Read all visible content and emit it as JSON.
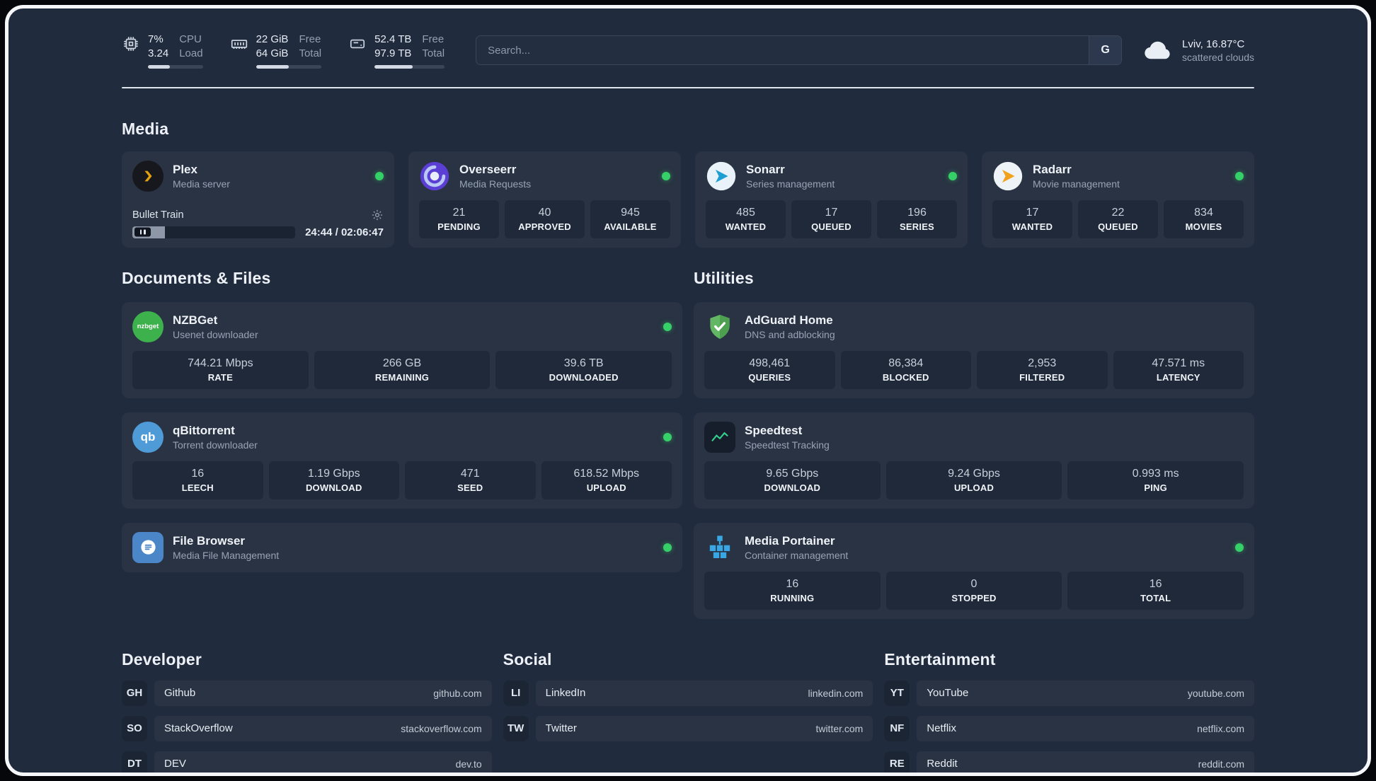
{
  "topbar": {
    "cpu": {
      "percent": "7%",
      "load": "3.24",
      "label_top": "CPU",
      "label_bottom": "Load",
      "bar_percent": 40
    },
    "ram": {
      "free": "22 GiB",
      "total": "64 GiB",
      "label_top": "Free",
      "label_bottom": "Total",
      "bar_percent": 50
    },
    "disk": {
      "free": "52.4 TB",
      "total": "97.9 TB",
      "label_top": "Free",
      "label_bottom": "Total",
      "bar_percent": 54
    },
    "search": {
      "placeholder": "Search...",
      "engine_label": "G"
    },
    "weather": {
      "location": "Lviv, 16.87°C",
      "condition": "scattered clouds",
      "icon": "cloud-icon"
    }
  },
  "sections": {
    "media": {
      "title": "Media",
      "plex": {
        "name": "Plex",
        "subtitle": "Media server",
        "icon": "plex-icon",
        "status": "online",
        "player": {
          "title": "Bullet Train",
          "time": "24:44 / 02:06:47",
          "progress_percent": 20
        }
      },
      "overseerr": {
        "name": "Overseerr",
        "subtitle": "Media Requests",
        "icon": "overseerr-icon",
        "status": "online",
        "stats": [
          {
            "value": "21",
            "label": "PENDING"
          },
          {
            "value": "40",
            "label": "APPROVED"
          },
          {
            "value": "945",
            "label": "AVAILABLE"
          }
        ]
      },
      "sonarr": {
        "name": "Sonarr",
        "subtitle": "Series management",
        "icon": "sonarr-icon",
        "status": "online",
        "stats": [
          {
            "value": "485",
            "label": "WANTED"
          },
          {
            "value": "17",
            "label": "QUEUED"
          },
          {
            "value": "196",
            "label": "SERIES"
          }
        ]
      },
      "radarr": {
        "name": "Radarr",
        "subtitle": "Movie management",
        "icon": "radarr-icon",
        "status": "online",
        "stats": [
          {
            "value": "17",
            "label": "WANTED"
          },
          {
            "value": "22",
            "label": "QUEUED"
          },
          {
            "value": "834",
            "label": "MOVIES"
          }
        ]
      }
    },
    "documents": {
      "title": "Documents & Files",
      "nzbget": {
        "name": "NZBGet",
        "subtitle": "Usenet downloader",
        "icon": "nzbget-icon",
        "status": "online",
        "stats": [
          {
            "value": "744.21 Mbps",
            "label": "RATE"
          },
          {
            "value": "266 GB",
            "label": "REMAINING"
          },
          {
            "value": "39.6 TB",
            "label": "DOWNLOADED"
          }
        ]
      },
      "qbittorrent": {
        "name": "qBittorrent",
        "subtitle": "Torrent downloader",
        "icon": "qbittorrent-icon",
        "status": "online",
        "stats": [
          {
            "value": "16",
            "label": "LEECH"
          },
          {
            "value": "1.19 Gbps",
            "label": "DOWNLOAD"
          },
          {
            "value": "471",
            "label": "SEED"
          },
          {
            "value": "618.52 Mbps",
            "label": "UPLOAD"
          }
        ]
      },
      "filebrowser": {
        "name": "File Browser",
        "subtitle": "Media File Management",
        "icon": "filebrowser-icon",
        "status": "online"
      }
    },
    "utilities": {
      "title": "Utilities",
      "adguard": {
        "name": "AdGuard Home",
        "subtitle": "DNS and adblocking",
        "icon": "adguard-icon",
        "stats": [
          {
            "value": "498,461",
            "label": "QUERIES"
          },
          {
            "value": "86,384",
            "label": "BLOCKED"
          },
          {
            "value": "2,953",
            "label": "FILTERED"
          },
          {
            "value": "47.571 ms",
            "label": "LATENCY"
          }
        ]
      },
      "speedtest": {
        "name": "Speedtest",
        "subtitle": "Speedtest Tracking",
        "icon": "speedtest-icon",
        "stats": [
          {
            "value": "9.65 Gbps",
            "label": "DOWNLOAD"
          },
          {
            "value": "9.24 Gbps",
            "label": "UPLOAD"
          },
          {
            "value": "0.993 ms",
            "label": "PING"
          }
        ]
      },
      "portainer": {
        "name": "Media Portainer",
        "subtitle": "Container management",
        "icon": "portainer-icon",
        "status": "online",
        "stats": [
          {
            "value": "16",
            "label": "RUNNING"
          },
          {
            "value": "0",
            "label": "STOPPED"
          },
          {
            "value": "16",
            "label": "TOTAL"
          }
        ]
      }
    }
  },
  "bookmarks": {
    "developer": {
      "title": "Developer",
      "items": [
        {
          "abbr": "GH",
          "name": "Github",
          "url": "github.com"
        },
        {
          "abbr": "SO",
          "name": "StackOverflow",
          "url": "stackoverflow.com"
        },
        {
          "abbr": "DT",
          "name": "DEV",
          "url": "dev.to"
        }
      ]
    },
    "social": {
      "title": "Social",
      "items": [
        {
          "abbr": "LI",
          "name": "LinkedIn",
          "url": "linkedin.com"
        },
        {
          "abbr": "TW",
          "name": "Twitter",
          "url": "twitter.com"
        }
      ]
    },
    "entertainment": {
      "title": "Entertainment",
      "items": [
        {
          "abbr": "YT",
          "name": "YouTube",
          "url": "youtube.com"
        },
        {
          "abbr": "NF",
          "name": "Netflix",
          "url": "netflix.com"
        },
        {
          "abbr": "RE",
          "name": "Reddit",
          "url": "reddit.com"
        }
      ]
    }
  },
  "colors": {
    "background": "#202b3d",
    "card": "#293343",
    "tile": "#1f2939",
    "status_online": "#36d068",
    "plex_accent": "#e5a00d",
    "frame_border": "#f5f7fa"
  }
}
